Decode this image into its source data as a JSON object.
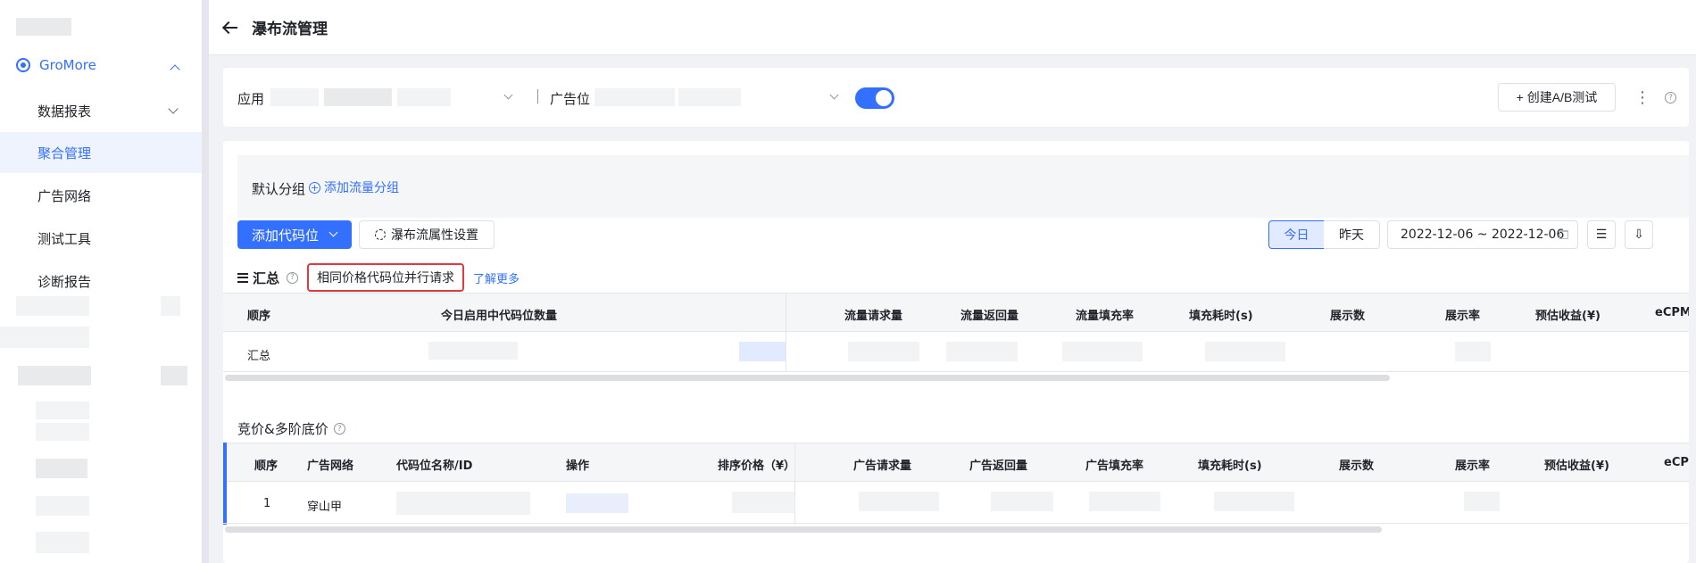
{
  "sidebar": {
    "top_item": {
      "label": "GroMore"
    },
    "items": [
      {
        "label": "数据报表"
      },
      {
        "label": "聚合管理"
      },
      {
        "label": "广告网络"
      },
      {
        "label": "测试工具"
      },
      {
        "label": "诊断报告"
      }
    ]
  },
  "header": {
    "title": "瀑布流管理"
  },
  "filters": {
    "app_label": "应用",
    "adslot_label": "广告位",
    "ab_test_label": "+ 创建A/B测试",
    "more": "⋮",
    "help": "?"
  },
  "group": {
    "title": "默认分组",
    "add_label": "添加流量分组"
  },
  "toolbar": {
    "add_code_label": "添加代码位",
    "waterfall_settings_label": "瀑布流属性设置",
    "today_label": "今日",
    "yesterday_label": "昨天",
    "date_range": "2022-12-06 ~ 2022-12-06"
  },
  "summary": {
    "title": "汇总",
    "highlight": "相同价格代码位并行请求",
    "learn_more": "了解更多",
    "headers": [
      "顺序",
      "今日启用中代码位数量",
      "流量请求量",
      "流量返回量",
      "流量填充率",
      "填充耗时(s)",
      "展示数",
      "展示率",
      "预估收益(¥)",
      "eCPM"
    ],
    "row_label": "汇总"
  },
  "bidding": {
    "title": "竞价&多阶底价",
    "headers": [
      "顺序",
      "广告网络",
      "代码位名称/ID",
      "操作",
      "排序价格（¥）",
      "广告请求量",
      "广告返回量",
      "广告填充率",
      "填充耗时(s)",
      "展示数",
      "展示率",
      "预估收益(¥)",
      "eCPM"
    ],
    "rows": [
      {
        "order": "1",
        "network": "穿山甲"
      }
    ]
  }
}
